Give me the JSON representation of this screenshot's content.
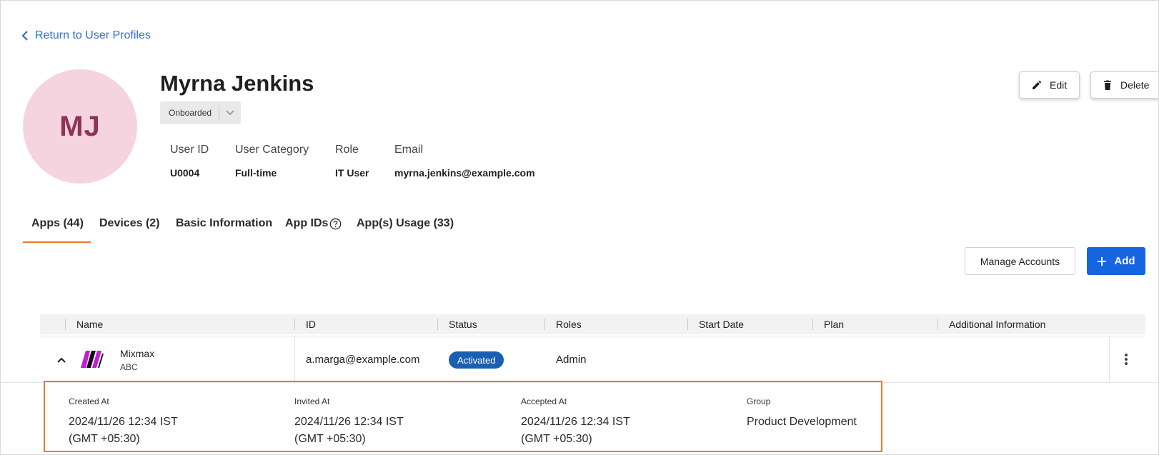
{
  "nav": {
    "back_label": "Return to User Profiles"
  },
  "profile": {
    "initials": "MJ",
    "name": "Myrna Jenkins",
    "status": "Onboarded",
    "fields": [
      {
        "label": "User ID",
        "value": "U0004"
      },
      {
        "label": "User Category",
        "value": "Full-time"
      },
      {
        "label": "Role",
        "value": "IT User"
      },
      {
        "label": "Email",
        "value": "myrna.jenkins@example.com"
      }
    ]
  },
  "actions": {
    "edit_label": "Edit",
    "delete_label": "Delete"
  },
  "tabs": [
    {
      "label": "Apps (44)",
      "active": true
    },
    {
      "label": "Devices (2)"
    },
    {
      "label": "Basic Information"
    },
    {
      "label": "App IDs"
    },
    {
      "label": "App(s) Usage (33)"
    }
  ],
  "toolbar": {
    "manage_label": "Manage Accounts",
    "add_label": "Add"
  },
  "table": {
    "columns": [
      "Name",
      "ID",
      "Status",
      "Roles",
      "Start Date",
      "Plan",
      "Additional Information"
    ],
    "rows": [
      {
        "name": "Mixmax",
        "org": "ABC",
        "id": "a.marga@example.com",
        "status": "Activated",
        "roles": "Admin",
        "start_date": "",
        "plan": "",
        "additional_info": ""
      }
    ]
  },
  "details": [
    {
      "label": "Created At",
      "line1": "2024/11/26 12:34 IST",
      "line2": "(GMT +05:30)"
    },
    {
      "label": "Invited At",
      "line1": "2024/11/26 12:34 IST",
      "line2": "(GMT +05:30)"
    },
    {
      "label": "Accepted At",
      "line1": "2024/11/26 12:34 IST",
      "line2": "(GMT +05:30)"
    },
    {
      "label": "Group",
      "line1": "Product Development",
      "line2": ""
    }
  ],
  "colors": {
    "link": "#2f6fd1",
    "accent_tab": "#e8792b",
    "primary_button": "#1565e0",
    "status_badge": "#1a5fb4",
    "avatar_bg": "#f5d4df",
    "avatar_text": "#8e3556",
    "highlight_border": "#ee7a30",
    "app_logo": "#c81ad6"
  },
  "icons": {
    "back": "chevron-left-icon",
    "status_dropdown": "chevron-down-icon",
    "edit": "pencil-icon",
    "delete": "trash-icon",
    "app_ids_help": "help-circle-icon",
    "add": "plus-icon",
    "row_expand": "chevron-up-icon",
    "row_menu": "kebab-menu-icon"
  }
}
